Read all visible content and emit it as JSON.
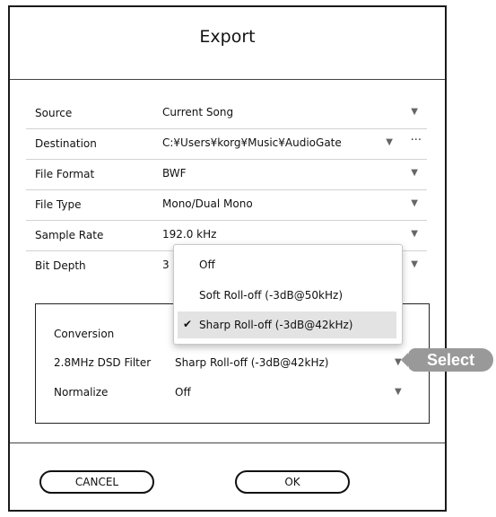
{
  "dialog": {
    "title": "Export",
    "rows": [
      {
        "label": "Source",
        "value": "Current Song"
      },
      {
        "label": "Destination",
        "value": "C:¥Users¥korg¥Music¥AudioGate",
        "more": "···"
      },
      {
        "label": "File Format",
        "value": "BWF"
      },
      {
        "label": "File Type",
        "value": "Mono/Dual Mono"
      },
      {
        "label": "Sample Rate",
        "value": "192.0 kHz"
      },
      {
        "label": "Bit Depth",
        "value": "3"
      }
    ],
    "conversion": {
      "label": "Conversion",
      "dsd_filter_label": "2.8MHz DSD Filter",
      "dsd_filter_value": "Sharp Roll-off (-3dB@42kHz)",
      "normalize_label": "Normalize",
      "normalize_value": "Off"
    },
    "dropdown": {
      "options": [
        "Off",
        "Soft Roll-off (-3dB@50kHz)",
        "Sharp Roll-off (-3dB@42kHz)"
      ],
      "selected_index": 2
    },
    "buttons": {
      "cancel": "CANCEL",
      "ok": "OK"
    }
  },
  "callout": {
    "label": "Select"
  },
  "icons": {
    "dropdown_arrow": "▼",
    "checkmark": "✔"
  },
  "colors": {
    "callout_bg": "#999999",
    "selected_bg": "#e3e3e3"
  }
}
